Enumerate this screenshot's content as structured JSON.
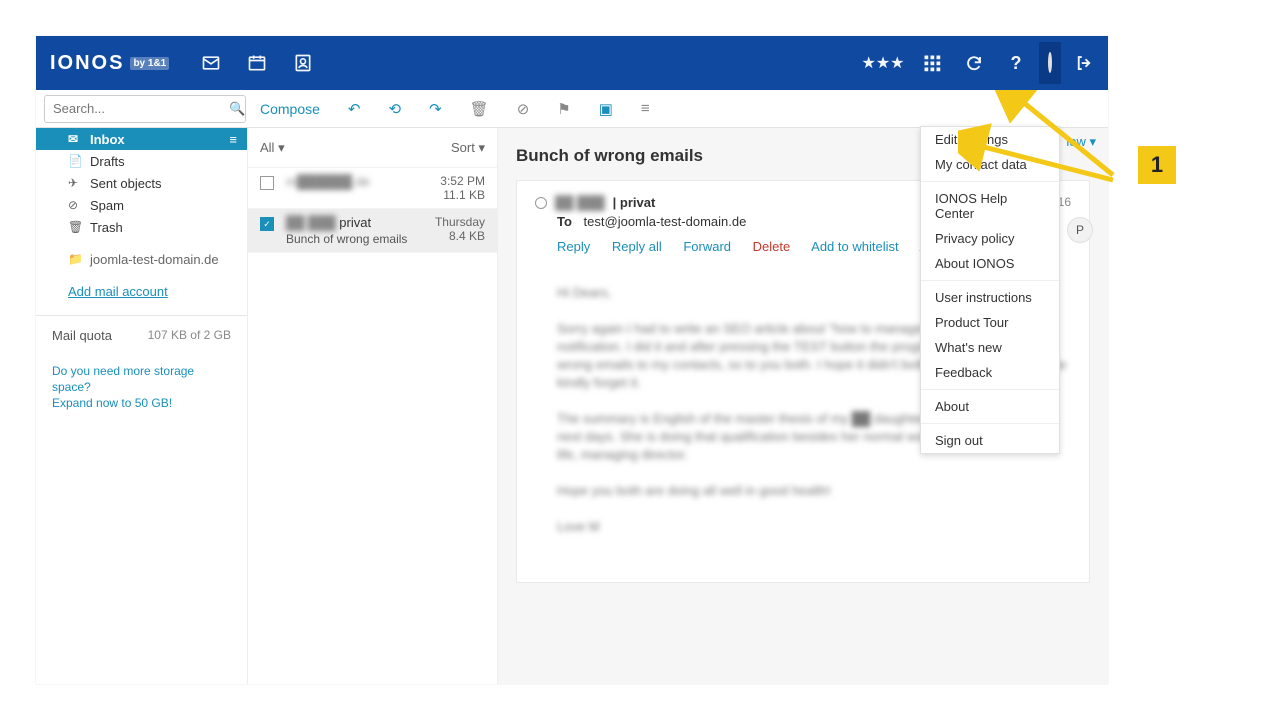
{
  "brand": {
    "name": "IONOS",
    "sub": "by 1&1"
  },
  "search": {
    "placeholder": "Search..."
  },
  "toolbar": {
    "compose": "Compose",
    "view": "iew"
  },
  "sidebar": {
    "folders": [
      {
        "name": "Inbox",
        "icon": "inbox"
      },
      {
        "name": "Drafts",
        "icon": "file"
      },
      {
        "name": "Sent objects",
        "icon": "plane"
      },
      {
        "name": "Spam",
        "icon": "nospam"
      },
      {
        "name": "Trash",
        "icon": "trash"
      }
    ],
    "account": "joomla-test-domain.de",
    "add_link": "Add mail account",
    "quota_label": "Mail quota",
    "quota_value": "107 KB of 2 GB",
    "hint_l1": "Do you need more storage space?",
    "hint_l2": "Expand now to 50 GB!"
  },
  "list": {
    "filter": "All",
    "sort": "Sort",
    "items": [
      {
        "from_blur": "m██████.de",
        "subject_blur": "",
        "time": "3:52 PM",
        "size": "11.1 KB"
      },
      {
        "from_blur": "██ ███",
        "from_clear": " privat",
        "subject": "Bunch of wrong emails",
        "time": "Thursday",
        "size": "8.4 KB"
      }
    ]
  },
  "viewer": {
    "subject": "Bunch of wrong emails",
    "from_blur": "██ ███ ",
    "from_suffix": "| privat",
    "date": "7/16",
    "to_label": "To",
    "to_addr": "test@joomla-test-domain.de",
    "pill": "P",
    "actions": {
      "reply": "Reply",
      "reply_all": "Reply all",
      "forward": "Forward",
      "delete": "Delete",
      "whitelist": "Add to whitelist",
      "blacklist": "Add to blacklist"
    },
    "body_blur": [
      "Hi Dears,",
      "Sorry again I had to write an SEO article about \"how to manage\" a completely different notification. I did it and after pressing the TEST button the programme sent a bunch of wrong emails to my contacts, so to you both. I hope it didn't bother you too much. Please kindly forget it.",
      "The summary is English of the master thesis of my ██ daughter is expected within the next days. She is doing that qualification besides her normal work as 'right hand' of the life, managing director.",
      "Hope you both are doing all well in good health!",
      "Love  M"
    ]
  },
  "menu": {
    "groups": [
      [
        "Edit Settings",
        "My contact data"
      ],
      [
        "IONOS Help Center",
        "Privacy policy",
        "About IONOS"
      ],
      [
        "User instructions",
        "Product Tour",
        "What's new",
        "Feedback"
      ],
      [
        "About"
      ],
      [
        "Sign out"
      ]
    ]
  },
  "callout": {
    "num": "1"
  }
}
